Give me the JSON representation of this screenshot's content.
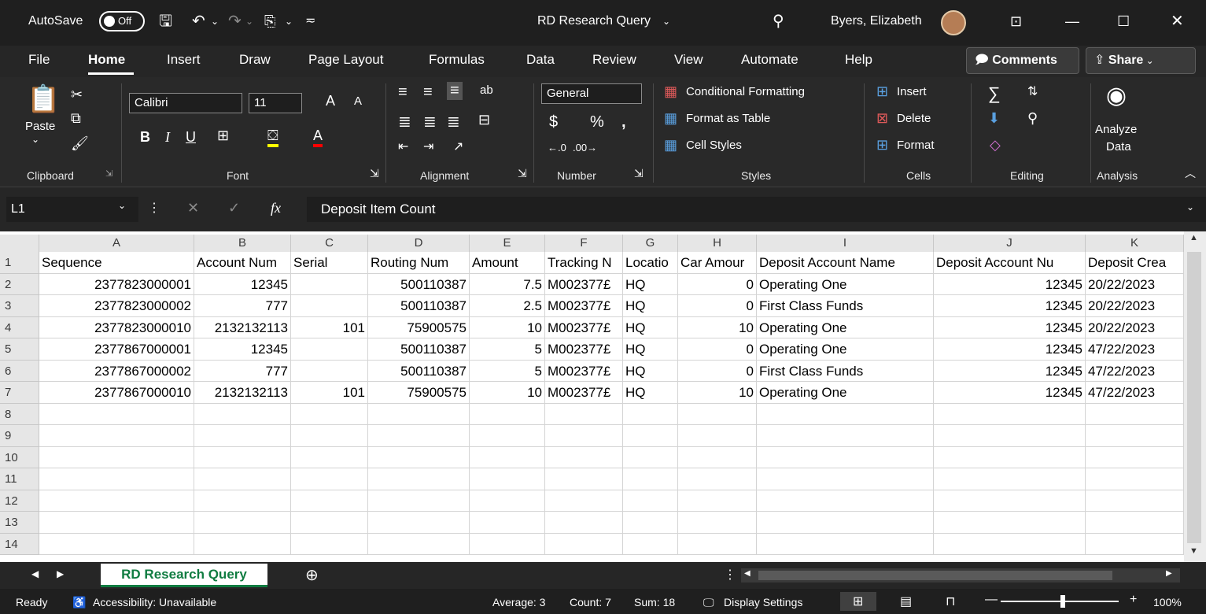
{
  "titlebar": {
    "autosave_label": "AutoSave",
    "autosave_state": "Off",
    "document_title": "RD Research Query",
    "user_name": "Byers, Elizabeth"
  },
  "menu": {
    "tabs": [
      "File",
      "Home",
      "Insert",
      "Draw",
      "Page Layout",
      "Formulas",
      "Data",
      "Review",
      "View",
      "Automate",
      "Help"
    ],
    "active": "Home",
    "comments_label": "Comments",
    "share_label": "Share"
  },
  "ribbon": {
    "clipboard": {
      "paste_label": "Paste",
      "group_label": "Clipboard"
    },
    "font": {
      "font_name": "Calibri",
      "font_size": "11",
      "group_label": "Font"
    },
    "alignment": {
      "group_label": "Alignment"
    },
    "number": {
      "format": "General",
      "group_label": "Number"
    },
    "styles": {
      "conditional_formatting": "Conditional Formatting",
      "format_as_table": "Format as Table",
      "cell_styles": "Cell Styles",
      "group_label": "Styles"
    },
    "cells": {
      "insert": "Insert",
      "delete": "Delete",
      "format": "Format",
      "group_label": "Cells"
    },
    "editing": {
      "group_label": "Editing"
    },
    "analysis": {
      "analyze_line1": "Analyze",
      "analyze_line2": "Data",
      "group_label": "Analysis"
    }
  },
  "formula_bar": {
    "cell_ref": "L1",
    "fx_label": "fx",
    "content": "Deposit Item Count"
  },
  "sheet": {
    "columns": [
      "A",
      "B",
      "C",
      "D",
      "E",
      "F",
      "G",
      "H",
      "I",
      "J",
      "K"
    ],
    "header_row": [
      "Sequence",
      "Account Num",
      "Serial",
      "Routing Num",
      "Amount",
      "Tracking N",
      "Locatio",
      "Car Amour",
      "Deposit Account Name",
      "Deposit Account Nu",
      "Deposit Crea"
    ],
    "rows": [
      [
        "2377823000001",
        "12345",
        "",
        "500110387",
        "7.5",
        "M002377£",
        "HQ",
        "0",
        "Operating One",
        "12345",
        "20/22/2023"
      ],
      [
        "2377823000002",
        "777",
        "",
        "500110387",
        "2.5",
        "M002377£",
        "HQ",
        "0",
        "First Class Funds",
        "12345",
        "20/22/2023"
      ],
      [
        "2377823000010",
        "2132132113",
        "101",
        "75900575",
        "10",
        "M002377£",
        "HQ",
        "10",
        "Operating One",
        "12345",
        "20/22/2023"
      ],
      [
        "2377867000001",
        "12345",
        "",
        "500110387",
        "5",
        "M002377£",
        "HQ",
        "0",
        "Operating One",
        "12345",
        "47/22/2023"
      ],
      [
        "2377867000002",
        "777",
        "",
        "500110387",
        "5",
        "M002377£",
        "HQ",
        "0",
        "First Class Funds",
        "12345",
        "47/22/2023"
      ],
      [
        "2377867000010",
        "2132132113",
        "101",
        "75900575",
        "10",
        "M002377£",
        "HQ",
        "10",
        "Operating One",
        "12345",
        "47/22/2023"
      ]
    ],
    "row_numbers": [
      "1",
      "2",
      "3",
      "4",
      "5",
      "6",
      "7",
      "8",
      "9",
      "10",
      "11",
      "12",
      "13",
      "14"
    ],
    "tab_name": "RD Research Query"
  },
  "status": {
    "ready": "Ready",
    "accessibility": "Accessibility: Unavailable",
    "average": "Average: 3",
    "count": "Count: 7",
    "sum": "Sum: 18",
    "display_settings": "Display Settings",
    "zoom": "100%"
  },
  "colors": {
    "excel_green": "#107c41",
    "chrome_dark": "#262626"
  }
}
